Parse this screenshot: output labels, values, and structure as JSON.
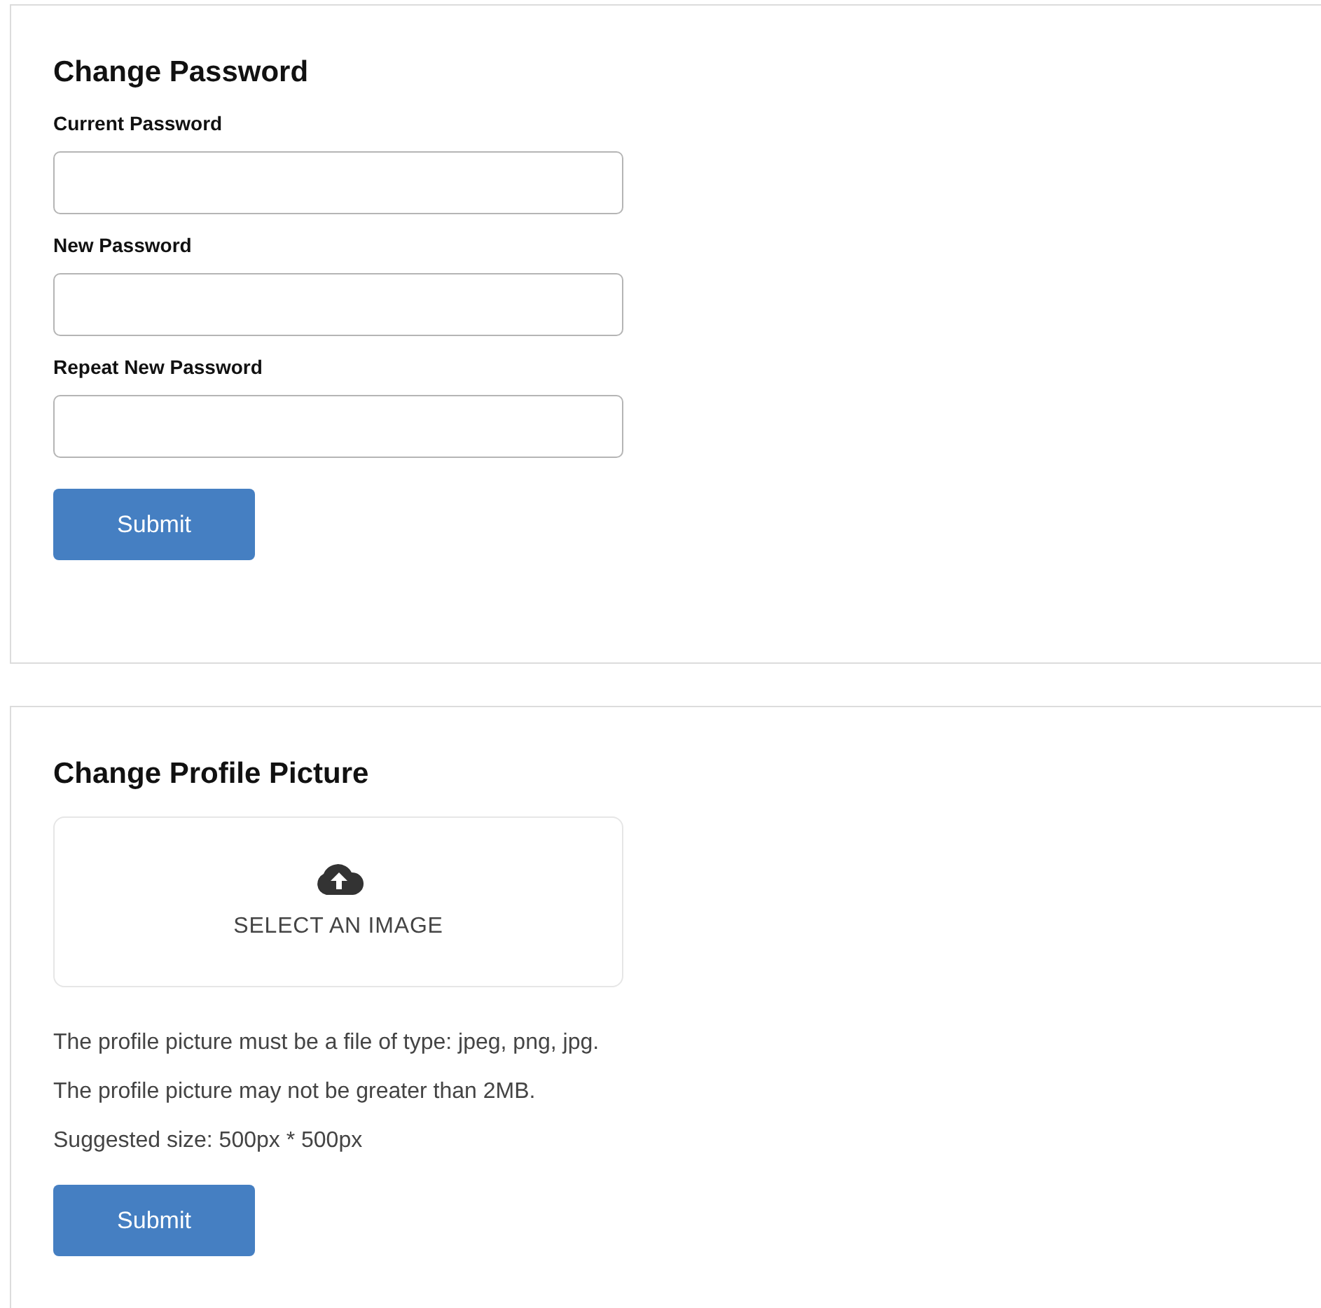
{
  "password_card": {
    "title": "Change Password",
    "fields": [
      {
        "label": "Current Password"
      },
      {
        "label": "New Password"
      },
      {
        "label": "Repeat New Password"
      }
    ],
    "submit": "Submit"
  },
  "picture_card": {
    "title": "Change Profile Picture",
    "dropzone": {
      "label": "SELECT AN IMAGE"
    },
    "notes": [
      "The profile picture must be a file of type: jpeg, png, jpg.",
      "The profile picture may not be greater than 2MB.",
      "Suggested size: 500px * 500px"
    ],
    "submit": "Submit"
  }
}
